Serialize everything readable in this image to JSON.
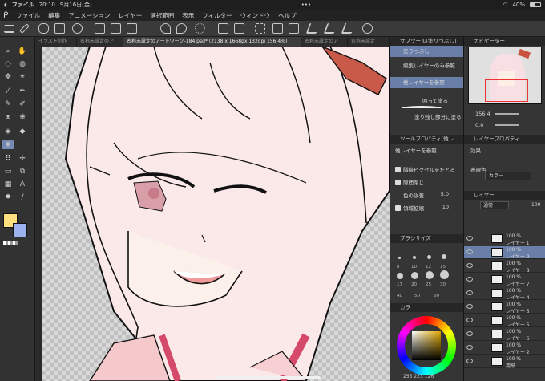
{
  "status": {
    "time": "20:10",
    "date": "9月16日(金)",
    "battery": "40%",
    "app_menu": "ファイル"
  },
  "menu": {
    "items": [
      "ファイル",
      "編集",
      "アニメーション",
      "レイヤー",
      "選択範囲",
      "表示",
      "フィルター",
      "ウィンドウ",
      "ヘルプ"
    ]
  },
  "tabs": [
    "イラスト制作",
    "名称未設定のア",
    "名称未設定のアートワーク-184.psd* (2138 x 1668px 132dpi 156.4%)",
    "名称未設定のア",
    "名称未設定"
  ],
  "subtool": {
    "title": "サブツール[塗りつぶし]",
    "items": [
      "塗りつぶし",
      "編集レイヤーのみ参照",
      "他レイヤーを参照",
      "囲って塗る",
      "塗り残し部分に塗る"
    ]
  },
  "toolprop": {
    "title": "ツールプロパティ[他レ",
    "header": "他レイヤーを参照",
    "options": [
      "隣接ピクセルをたどる",
      "隙間閉じ",
      "色の誤差",
      "領域拡縮"
    ],
    "values": [
      "5.0",
      "10"
    ]
  },
  "brushsize": {
    "title": "ブラシサイズ",
    "sizes": [
      "8",
      "10",
      "12",
      "15",
      "17",
      "20",
      "25",
      "30",
      "40",
      "50",
      "60"
    ]
  },
  "color": {
    "title": "カラ",
    "rgb": "255 223 126",
    "fg": "#ffe07e",
    "bg": "#9bb2ee"
  },
  "navigator": {
    "title": "ナビゲーター",
    "zoom": "156.4",
    "rotation": "0.0"
  },
  "layerprop": {
    "title": "レイヤープロパティ",
    "effect": "効果",
    "expression": "表現色",
    "expression_value": "カラー"
  },
  "layers": {
    "title": "レイヤー",
    "blend": "通常",
    "opacity": "100",
    "items": [
      {
        "pct": "100 %",
        "mode": "通",
        "name": "レイヤー 1"
      },
      {
        "pct": "100 %",
        "mode": "通",
        "name": "レイヤー 9"
      },
      {
        "pct": "100 %",
        "mode": "通",
        "name": "レイヤー 8"
      },
      {
        "pct": "100 %",
        "mode": "通",
        "name": "レイヤー 7"
      },
      {
        "pct": "100 %",
        "mode": "通",
        "name": "レイヤー 4"
      },
      {
        "pct": "100 %",
        "mode": "通",
        "name": "レイヤー 3"
      },
      {
        "pct": "100 %",
        "mode": "通",
        "name": "レイヤー 5"
      },
      {
        "pct": "100 %",
        "mode": "通",
        "name": "レイヤー 6"
      },
      {
        "pct": "100 %",
        "mode": "通",
        "name": "レイヤー 2"
      },
      {
        "pct": "100 %",
        "mode": "通",
        "name": "用紙"
      }
    ]
  }
}
